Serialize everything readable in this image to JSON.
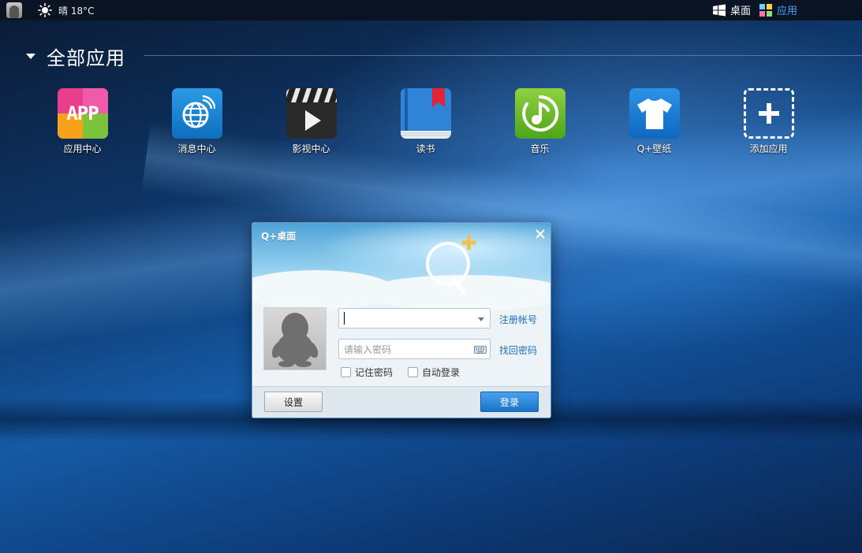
{
  "topbar": {
    "weather": "晴 18°C",
    "desktop_label": "桌面",
    "apps_label": "应用"
  },
  "section": {
    "title": "全部应用"
  },
  "apps": [
    {
      "label": "应用中心",
      "icon": "app-center-icon",
      "icon_text": "APP"
    },
    {
      "label": "消息中心",
      "icon": "message-center-icon"
    },
    {
      "label": "影视中心",
      "icon": "video-center-icon"
    },
    {
      "label": "读书",
      "icon": "book-icon"
    },
    {
      "label": "音乐",
      "icon": "music-icon"
    },
    {
      "label": "Q+壁纸",
      "icon": "wallpaper-icon"
    },
    {
      "label": "添加应用",
      "icon": "add-app-icon"
    }
  ],
  "login_dialog": {
    "title": "Q+桌面",
    "account_value": "",
    "password_placeholder": "请输入密码",
    "register_link": "注册帐号",
    "forgot_link": "找回密码",
    "remember_password": "记住密码",
    "auto_login": "自动登录",
    "settings_button": "设置",
    "login_button": "登录"
  },
  "colors": {
    "accent": "#4aa3ff",
    "login_button": "#1b73cb",
    "link": "#1f6fb8"
  }
}
